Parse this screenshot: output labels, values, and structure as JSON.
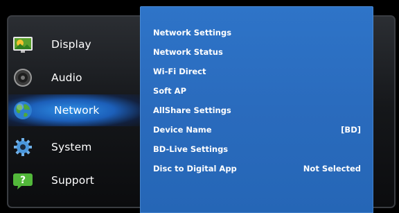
{
  "main_menu": {
    "items": [
      {
        "label": "Display",
        "icon": "display-icon",
        "selected": false
      },
      {
        "label": "Audio",
        "icon": "audio-icon",
        "selected": false
      },
      {
        "label": "Network",
        "icon": "network-icon",
        "selected": true
      },
      {
        "label": "System",
        "icon": "system-icon",
        "selected": false
      },
      {
        "label": "Support",
        "icon": "support-icon",
        "selected": false
      }
    ]
  },
  "network_menu": {
    "items": [
      {
        "label": "Network Settings",
        "value": ""
      },
      {
        "label": "Network Status",
        "value": ""
      },
      {
        "label": "Wi-Fi Direct",
        "value": ""
      },
      {
        "label": "Soft AP",
        "value": ""
      },
      {
        "label": "AllShare Settings",
        "value": ""
      },
      {
        "label": "Device Name",
        "value": "[BD]"
      },
      {
        "label": "BD-Live Settings",
        "value": ""
      },
      {
        "label": "Disc to Digital App",
        "value": "Not Selected"
      }
    ]
  },
  "colors": {
    "submenu_bg": "#2a6bbd",
    "selected_glow": "#2e8fe6",
    "panel_bg": "#15171a",
    "text": "#ffffff"
  }
}
